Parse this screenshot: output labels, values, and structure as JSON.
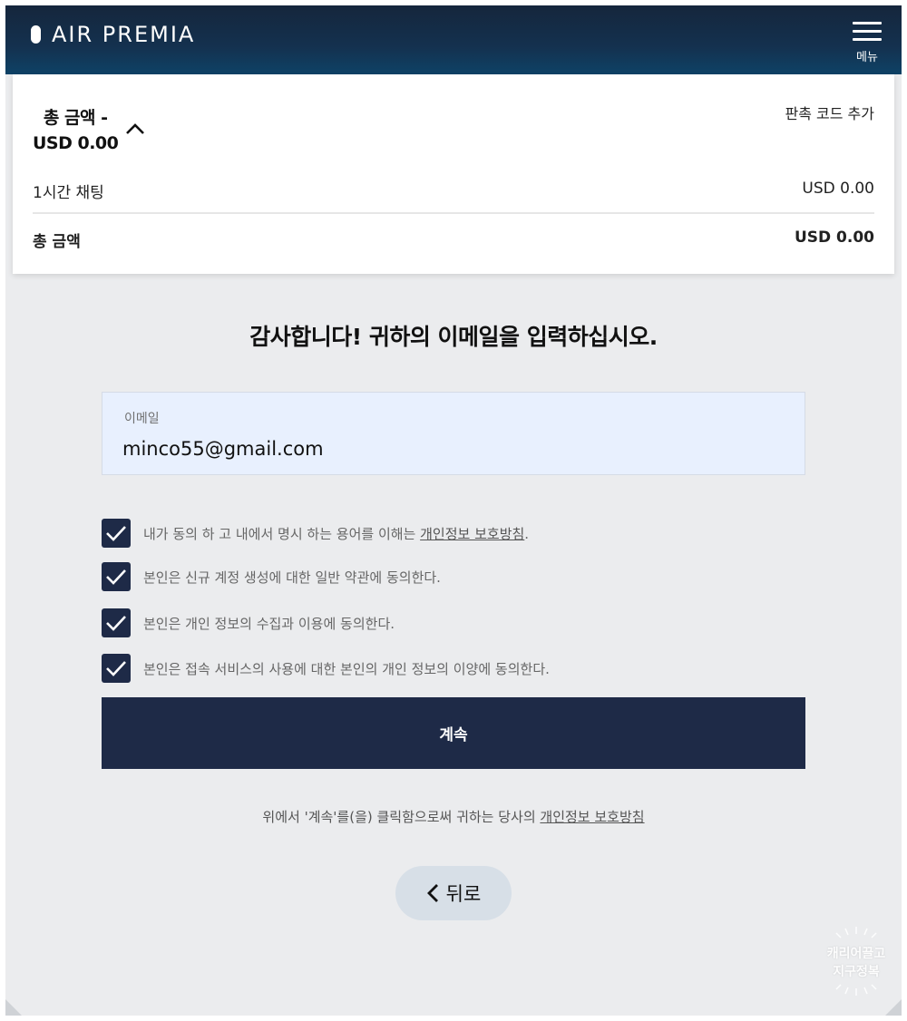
{
  "header": {
    "logo_text": "AIR PREMIA",
    "menu_label": "메뉴"
  },
  "summary": {
    "total_title": "총 금액 -",
    "total_amount": "USD 0.00",
    "promo_link": "판촉 코드 추가",
    "items": [
      {
        "label": "1시간 채팅",
        "amount": "USD 0.00"
      }
    ],
    "grand_total_label": "총 금액",
    "grand_total_amount": "USD 0.00"
  },
  "form": {
    "headline": "감사합니다! 귀하의 이메일을 입력하십시오.",
    "email_label": "이메일",
    "email_value": "minco55@gmail.com",
    "checks": [
      {
        "text": "내가 동의 하 고 내에서 명시 하는 용어를 이해는 ",
        "link": "개인정보 보호방침",
        "suffix": ".",
        "checked": true
      },
      {
        "text": "본인은 신규 계정 생성에 대한 일반 약관에 동의한다.",
        "checked": true
      },
      {
        "text": "본인은 개인 정보의 수집과 이용에 동의한다.",
        "checked": true
      },
      {
        "text": "본인은 접속 서비스의 사용에 대한 본인의 개인 정보의 이양에 동의한다.",
        "checked": true
      }
    ],
    "continue_label": "계속",
    "disclaimer_text": "위에서 '계속'를(을) 클릭함으로써 귀하는 당사의 ",
    "disclaimer_link": "개인정보 보호방침",
    "back_label": "뒤로"
  },
  "watermark": {
    "line1": "캐리어끌고",
    "line2": "지구정복"
  },
  "colors": {
    "header": "#14314f",
    "primary": "#1e2a47",
    "input_bg": "#e8f0fe",
    "page_bg": "#ebecee",
    "back_button": "#d7dfe7"
  }
}
